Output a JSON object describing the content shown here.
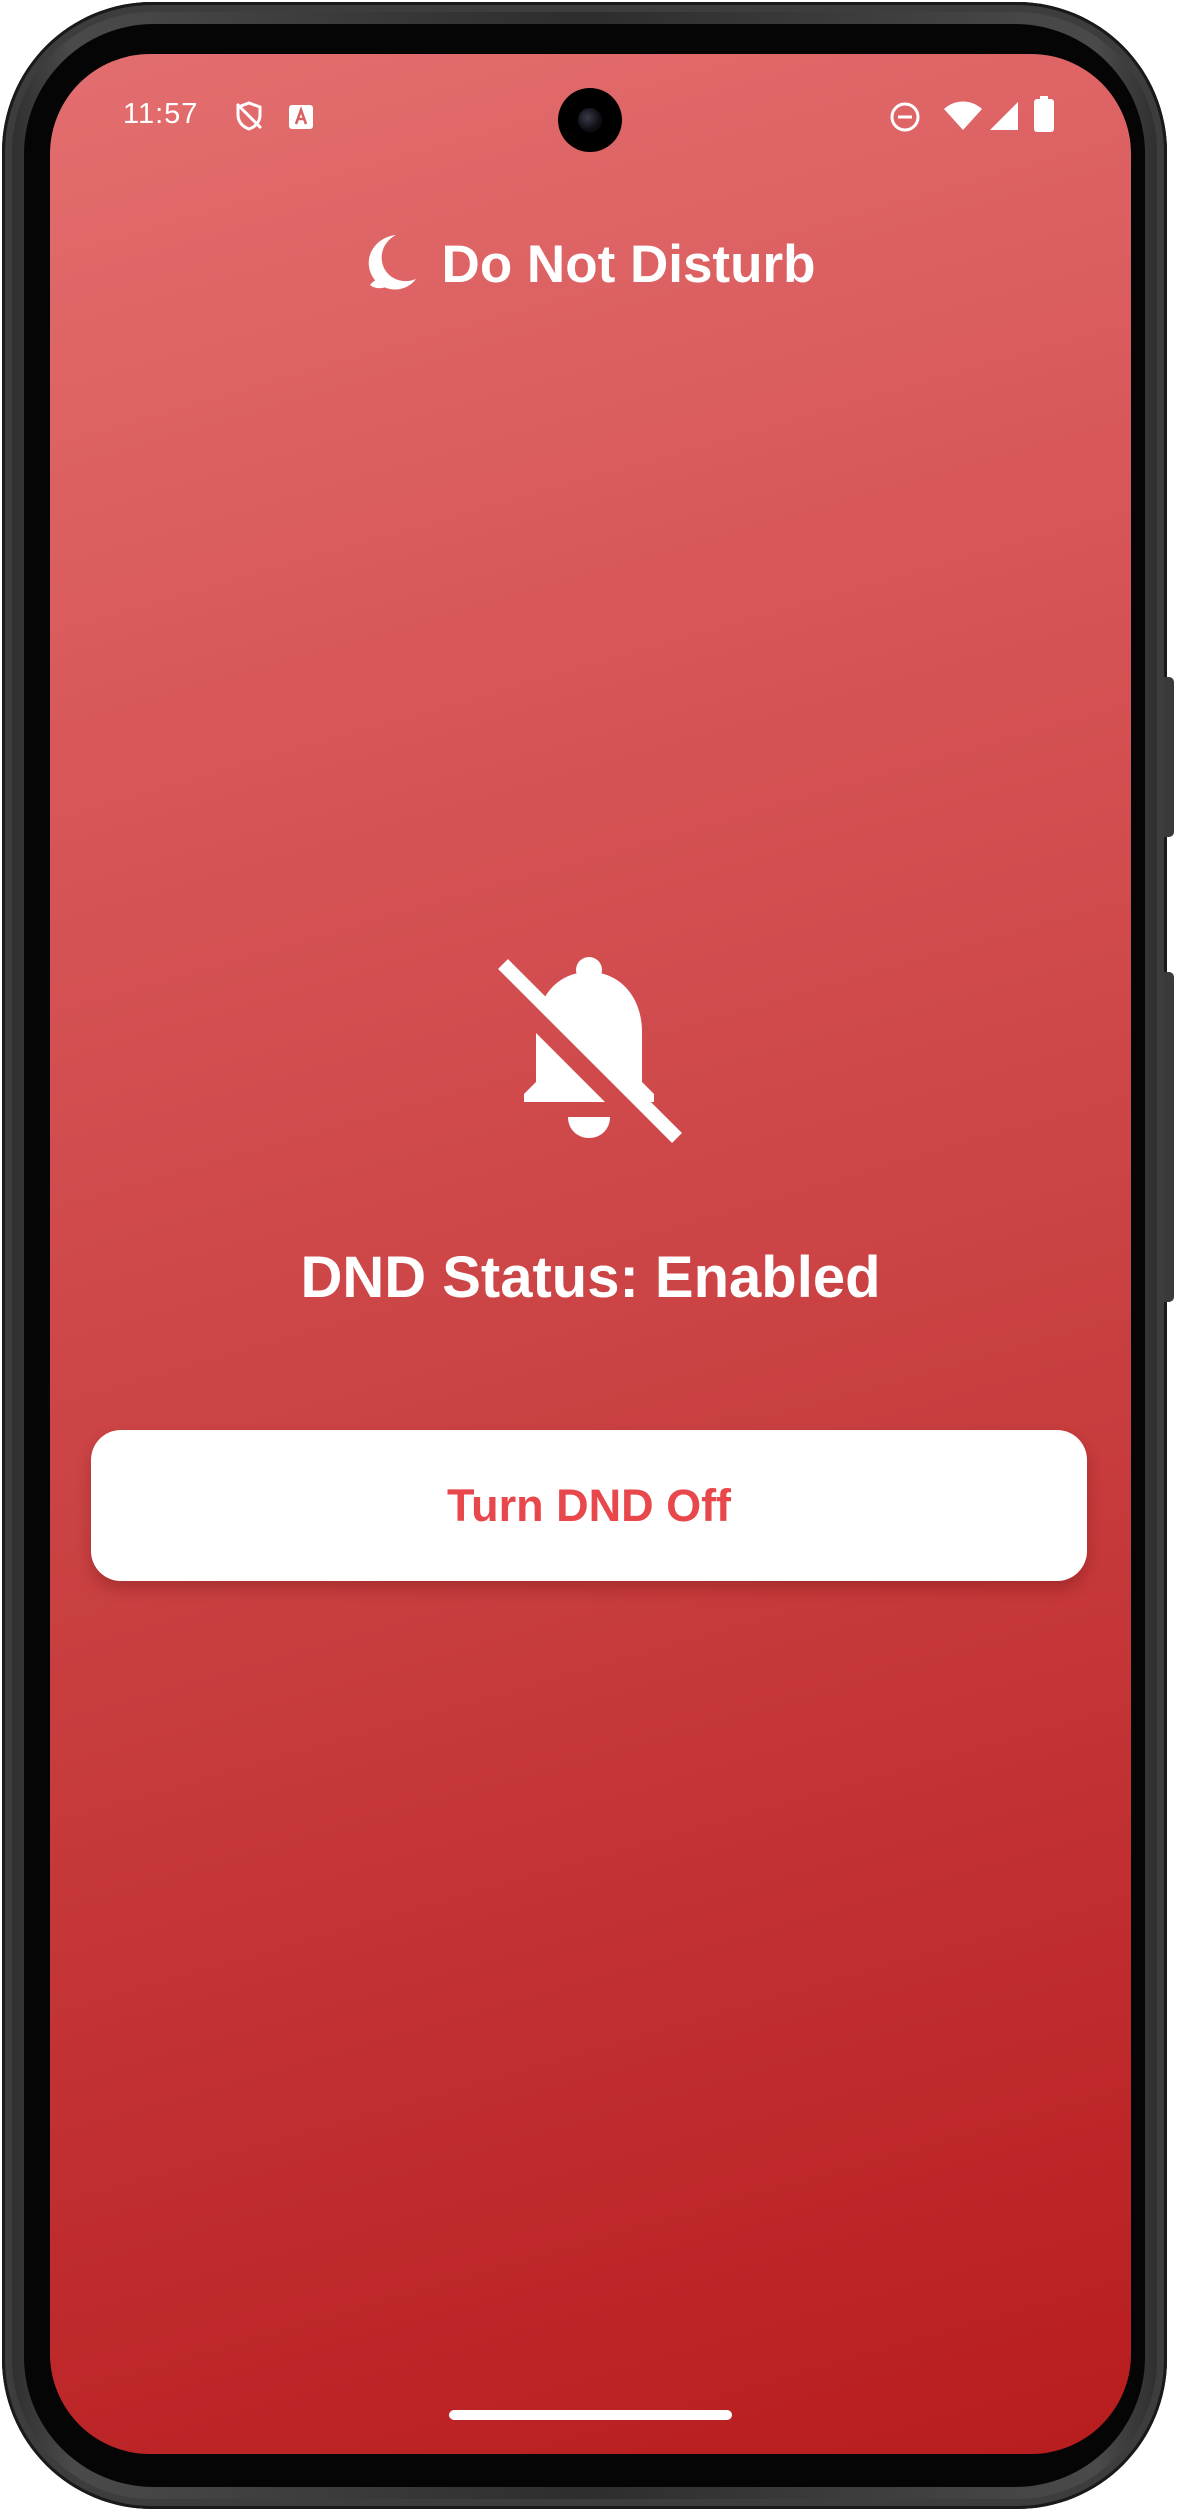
{
  "status_bar": {
    "time": "11:57",
    "icons": [
      "vpn-shield-icon",
      "keyboard-a-icon",
      "dnd-minus-icon",
      "wifi-icon",
      "signal-icon",
      "battery-icon"
    ]
  },
  "header": {
    "icon": "moon-icon",
    "title": "Do Not Disturb"
  },
  "main": {
    "status_icon": "bell-off-icon",
    "status_text": "DND Status: Enabled",
    "button_label": "Turn DND Off"
  },
  "colors": {
    "gradient_top": "#e36e6f",
    "gradient_bottom": "#b81c1e",
    "button_text": "#e8474b",
    "button_bg": "#ffffff"
  }
}
